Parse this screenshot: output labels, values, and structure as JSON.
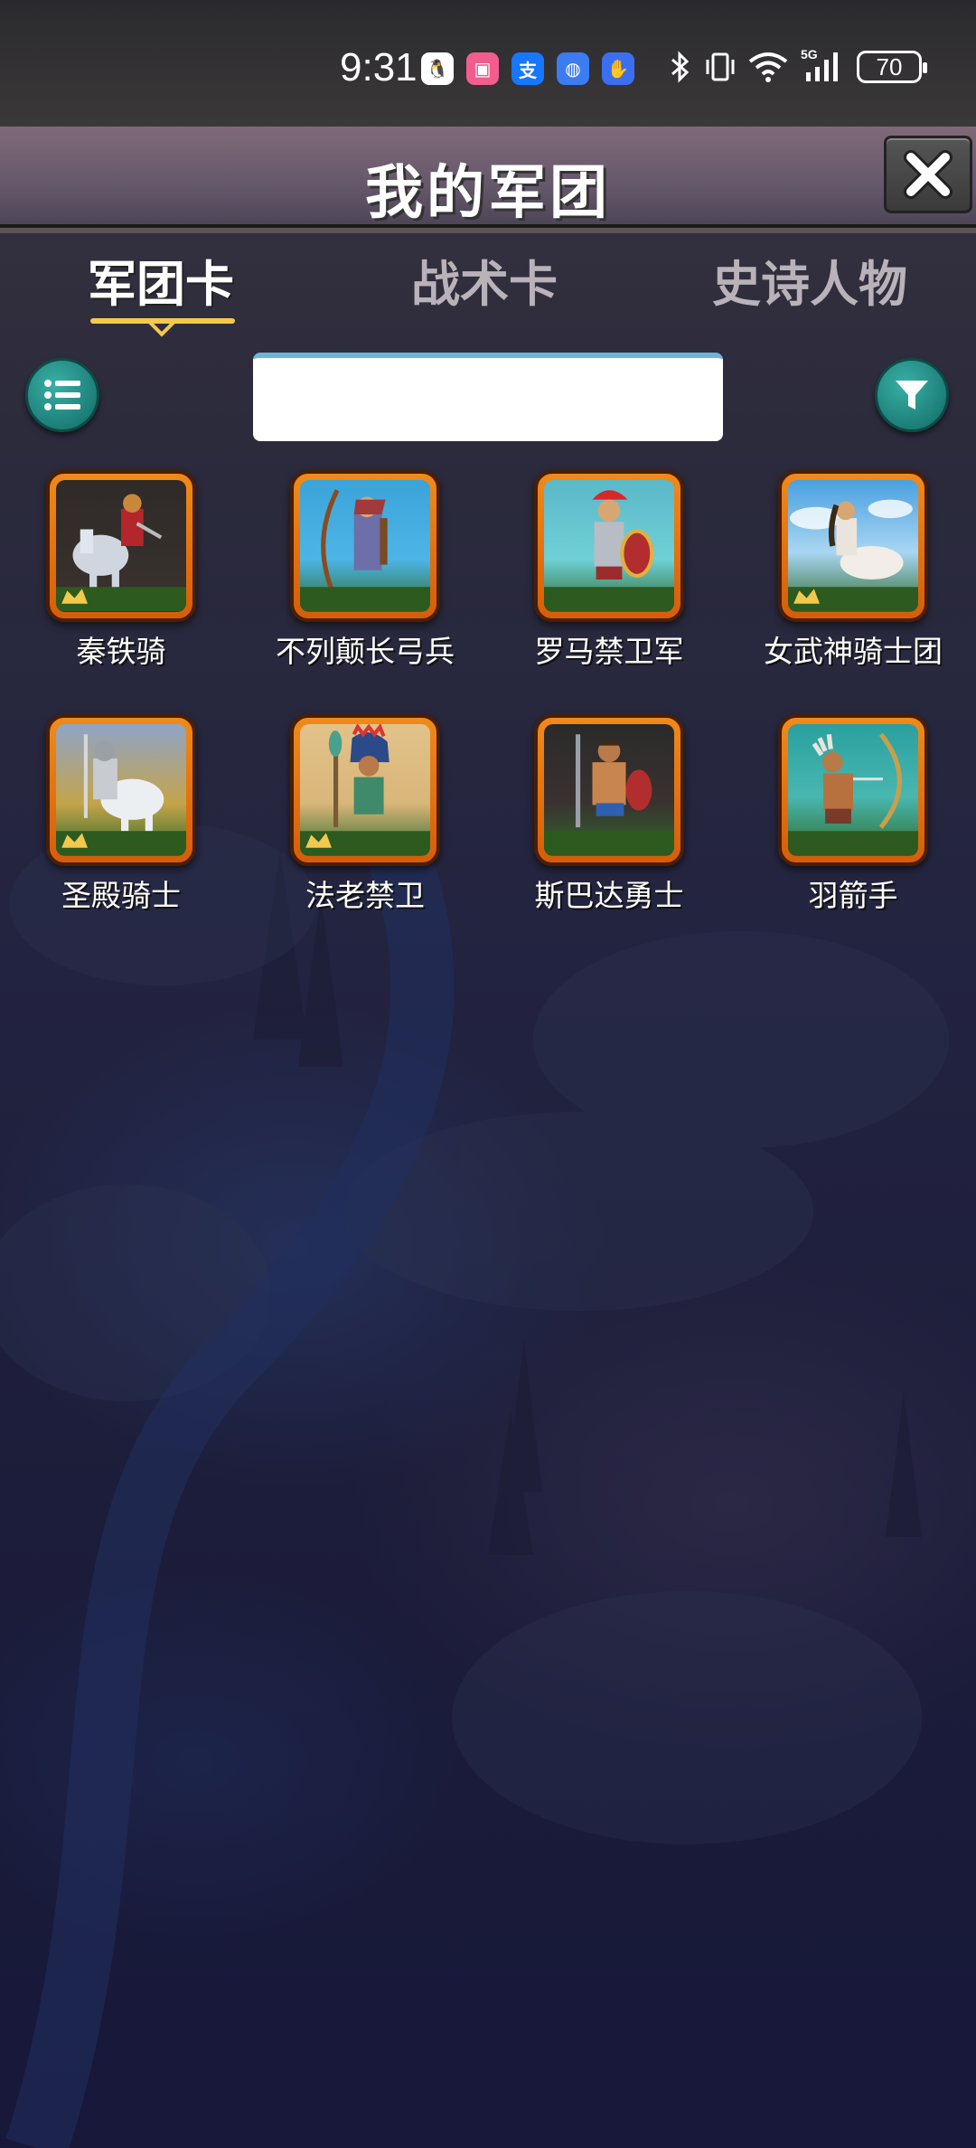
{
  "status_bar": {
    "time": "9:31",
    "battery": "70",
    "network": "5G",
    "app_icons": [
      "qq-icon",
      "bilibili-icon",
      "alipay-icon",
      "browser-icon",
      "accessibility-icon"
    ]
  },
  "header": {
    "title": "我的军团",
    "close_icon": "close-icon"
  },
  "tabs": [
    {
      "label": "军团卡",
      "active": true
    },
    {
      "label": "战术卡",
      "active": false
    },
    {
      "label": "史诗人物",
      "active": false
    }
  ],
  "toolbar": {
    "list_icon": "list-icon",
    "filter_icon": "filter-icon",
    "search_value": ""
  },
  "cards": [
    {
      "name": "秦铁骑",
      "rarity": "gold-crown",
      "art": "cavalry-knight"
    },
    {
      "name": "不列颠长弓兵",
      "rarity": "normal",
      "art": "longbow-archer"
    },
    {
      "name": "罗马禁卫军",
      "rarity": "normal",
      "art": "roman-guard"
    },
    {
      "name": "女武神骑士团",
      "rarity": "gold-crown",
      "art": "valkyrie-rider"
    },
    {
      "name": "圣殿骑士",
      "rarity": "gold-crown",
      "art": "templar-knight"
    },
    {
      "name": "法老禁卫",
      "rarity": "gold-crown",
      "art": "pharaoh-guard"
    },
    {
      "name": "斯巴达勇士",
      "rarity": "normal",
      "art": "spartan-warrior"
    },
    {
      "name": "羽箭手",
      "rarity": "normal",
      "art": "feather-archer"
    }
  ],
  "colors": {
    "card_border": "#f08a1a",
    "round_button": "#1d7e78",
    "tab_underline": "#f2c94c",
    "crown": "#f2c94c"
  }
}
